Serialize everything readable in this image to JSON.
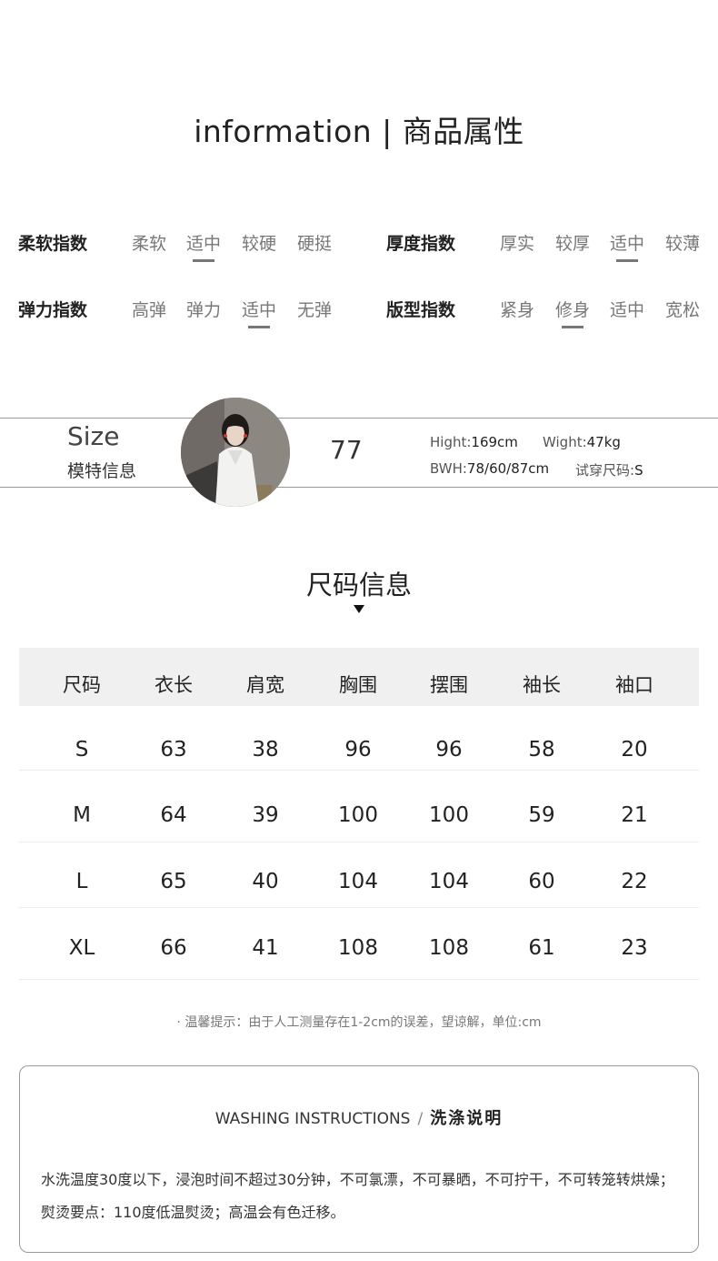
{
  "header": {
    "title": "information | 商品属性"
  },
  "attributes": {
    "softness": {
      "label": "柔软指数",
      "options": [
        "柔软",
        "适中",
        "较硬",
        "硬挺"
      ],
      "selected": "适中"
    },
    "thickness": {
      "label": "厚度指数",
      "options": [
        "厚实",
        "较厚",
        "适中",
        "较薄"
      ],
      "selected": "适中"
    },
    "elasticity": {
      "label": "弹力指数",
      "options": [
        "高弹",
        "弹力",
        "适中",
        "无弹"
      ],
      "selected": "适中"
    },
    "fit": {
      "label": "版型指数",
      "options": [
        "紧身",
        "修身",
        "适中",
        "宽松"
      ],
      "selected": "修身"
    }
  },
  "model": {
    "size_en": "Size",
    "size_cn": "模特信息",
    "number": "77",
    "height_label": "Hight:",
    "height": "169cm",
    "weight_label": "Wight:",
    "weight": "47kg",
    "bwh_label": "BWH:",
    "bwh": "78/60/87cm",
    "trial_label": "试穿尺码:",
    "trial": "S"
  },
  "size_chart": {
    "title": "尺码信息",
    "headers": [
      "尺码",
      "衣长",
      "肩宽",
      "胸围",
      "摆围",
      "袖长",
      "袖口"
    ],
    "rows": [
      [
        "S",
        "63",
        "38",
        "96",
        "96",
        "58",
        "20"
      ],
      [
        "M",
        "64",
        "39",
        "100",
        "100",
        "59",
        "21"
      ],
      [
        "L",
        "65",
        "40",
        "104",
        "104",
        "60",
        "22"
      ],
      [
        "XL",
        "66",
        "41",
        "108",
        "108",
        "61",
        "23"
      ]
    ],
    "note": "· 温馨提示：由于人工测量存在1-2cm的误差，望谅解，单位:cm"
  },
  "washing": {
    "title_en": "WASHING INSTRUCTIONS",
    "title_sep": "/",
    "title_cn": "洗涤说明",
    "line1": "水洗温度30度以下，浸泡时间不超过30分钟，不可氯漂，不可暴晒，不可拧干，不可转笼转烘燥；",
    "line2": "熨烫要点：110度低温熨烫；高温会有色迁移。"
  }
}
